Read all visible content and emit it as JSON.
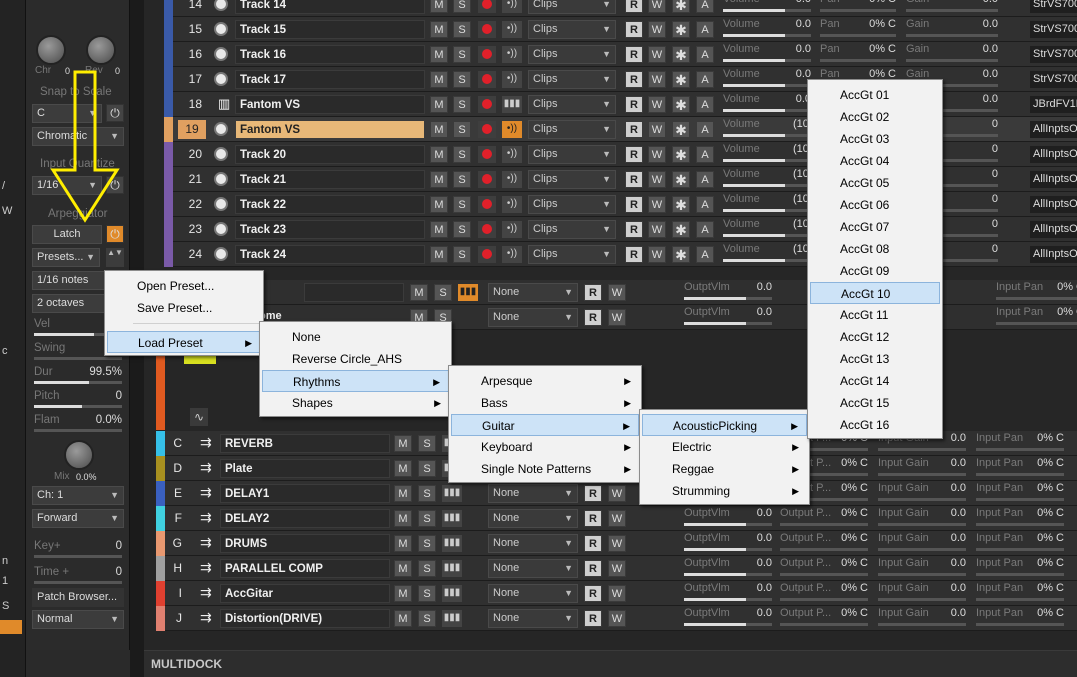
{
  "inspector": {
    "knob_labels": [
      "Chr",
      "Rev"
    ],
    "knob_values": [
      "0",
      "0"
    ],
    "snap_to_scale_label": "Snap to Scale",
    "scale_key": "C",
    "scale_type": "Chromatic",
    "input_quantize_label": "Input Quantize",
    "quantize_value": "1/16",
    "arpeggiator_label": "Arpeggiator",
    "latch_label": "Latch",
    "presets_label": "Presets...",
    "rate": "1/16 notes",
    "octaves": "2 octaves",
    "vel_label": "Vel",
    "vel_value": "1",
    "swing_label": "Swing",
    "swing_value": "0%",
    "dur_label": "Dur",
    "dur_value": "99.5%",
    "pitch_label": "Pitch",
    "pitch_value": "0",
    "flam_label": "Flam",
    "flam_value": "0.0%",
    "mix_label": "Mix",
    "mix_value": "0.0%",
    "channel": "Ch: 1",
    "direction": "Forward",
    "key_label": "Key+",
    "key_value": "0",
    "time_label": "Time +",
    "time_value": "0",
    "patch_browser": "Patch Browser...",
    "mode": "Normal"
  },
  "left_strip": {
    "chars": [
      "/",
      "W",
      "c",
      "n",
      "1",
      "S"
    ]
  },
  "track_rows": [
    {
      "num": "14",
      "name": "Track 14",
      "color": "#3a5aa8",
      "type": "midi",
      "out": "StrVS700..."
    },
    {
      "num": "15",
      "name": "Track 15",
      "color": "#3a5aa8",
      "type": "midi",
      "out": "StrVS700..."
    },
    {
      "num": "16",
      "name": "Track 16",
      "color": "#3a5aa8",
      "type": "midi",
      "out": "StrVS700..."
    },
    {
      "num": "17",
      "name": "Track 17",
      "color": "#3a5aa8",
      "type": "midi",
      "out": "StrVS700..."
    },
    {
      "num": "18",
      "name": "Fantom VS",
      "color": "#3a5aa8",
      "type": "audio",
      "out": "JBrdFV1P..."
    },
    {
      "num": "19",
      "name": "Fantom VS",
      "color": "#e0a060",
      "type": "midi",
      "out": "AllInptsO...",
      "selected": true
    },
    {
      "num": "20",
      "name": "Track 20",
      "color": "#7a5aa8",
      "type": "midi",
      "out": "AllInptsO..."
    },
    {
      "num": "21",
      "name": "Track 21",
      "color": "#7a5aa8",
      "type": "midi",
      "out": "AllInptsO..."
    },
    {
      "num": "22",
      "name": "Track 22",
      "color": "#7a5aa8",
      "type": "midi",
      "out": "AllInptsO..."
    },
    {
      "num": "23",
      "name": "Track 23",
      "color": "#7a5aa8",
      "type": "midi",
      "out": "AllInptsO..."
    },
    {
      "num": "24",
      "name": "Track 24",
      "color": "#7a5aa8",
      "type": "midi",
      "out": "AllInptsO..."
    }
  ],
  "track_labels": {
    "m": "M",
    "s": "S",
    "r": "R",
    "w": "W",
    "a": "A",
    "clips": "Clips",
    "volume": "Volume",
    "pan": "Pan",
    "pan_value": "0% C",
    "gain": "Gain",
    "vol_value": "0.0",
    "vol_101": "(101",
    "gain_value": "0.0",
    "gain_zero": "0"
  },
  "bus_rows": [
    {
      "letter": "C",
      "name": "REVERB",
      "color": "#36c0e8"
    },
    {
      "letter": "D",
      "name": "Plate",
      "color": "#a89020"
    },
    {
      "letter": "E",
      "name": "DELAY1",
      "color": "#3a60c0"
    },
    {
      "letter": "F",
      "name": "DELAY2",
      "color": "#40d0e0"
    },
    {
      "letter": "G",
      "name": "DRUMS",
      "color": "#e89870"
    },
    {
      "letter": "H",
      "name": "PARALLEL COMP",
      "color": "#a0a0a0"
    },
    {
      "letter": "I",
      "name": "AccGitar",
      "color": "#e04030"
    },
    {
      "letter": "J",
      "name": "Distortion(DRIVE)",
      "color": "#e08070"
    }
  ],
  "bus_labels": {
    "none": "None",
    "output_vlm": "OutptVlm",
    "output_p": "Output P...",
    "pan_value": "0% C",
    "vol_value": "0.0",
    "input_gain": "Input Gain",
    "input_pan": "Input Pan",
    "gain_value": "0.0",
    "ipan_value": "0% C"
  },
  "partial_rows": [
    {
      "name": "",
      "none": "None"
    },
    {
      "name": "ome",
      "none": "None"
    }
  ],
  "menus": {
    "presets_menu": [
      "Open Preset...",
      "Save Preset...",
      "Load Preset"
    ],
    "load_preset_menu": [
      "None",
      "Reverse Circle_AHS",
      "Rhythms",
      "Shapes"
    ],
    "rhythms_menu": [
      "Arpesque",
      "Bass",
      "Guitar",
      "Keyboard",
      "Single Note Patterns"
    ],
    "guitar_menu": [
      "AcousticPicking",
      "Electric",
      "Reggae",
      "Strumming"
    ],
    "acoustic_menu": [
      "AccGt 01",
      "AccGt 02",
      "AccGt 03",
      "AccGt 04",
      "AccGt 05",
      "AccGt 06",
      "AccGt 07",
      "AccGt 08",
      "AccGt 09",
      "AccGt 10",
      "AccGt 11",
      "AccGt 12",
      "AccGt 13",
      "AccGt 14",
      "AccGt 15",
      "AccGt 16"
    ]
  },
  "multidock_label": "MULTIDOCK",
  "colors": {
    "arrow": "#ffee00",
    "accent_orange": "#e08a2a",
    "record_red": "#e0202a"
  }
}
